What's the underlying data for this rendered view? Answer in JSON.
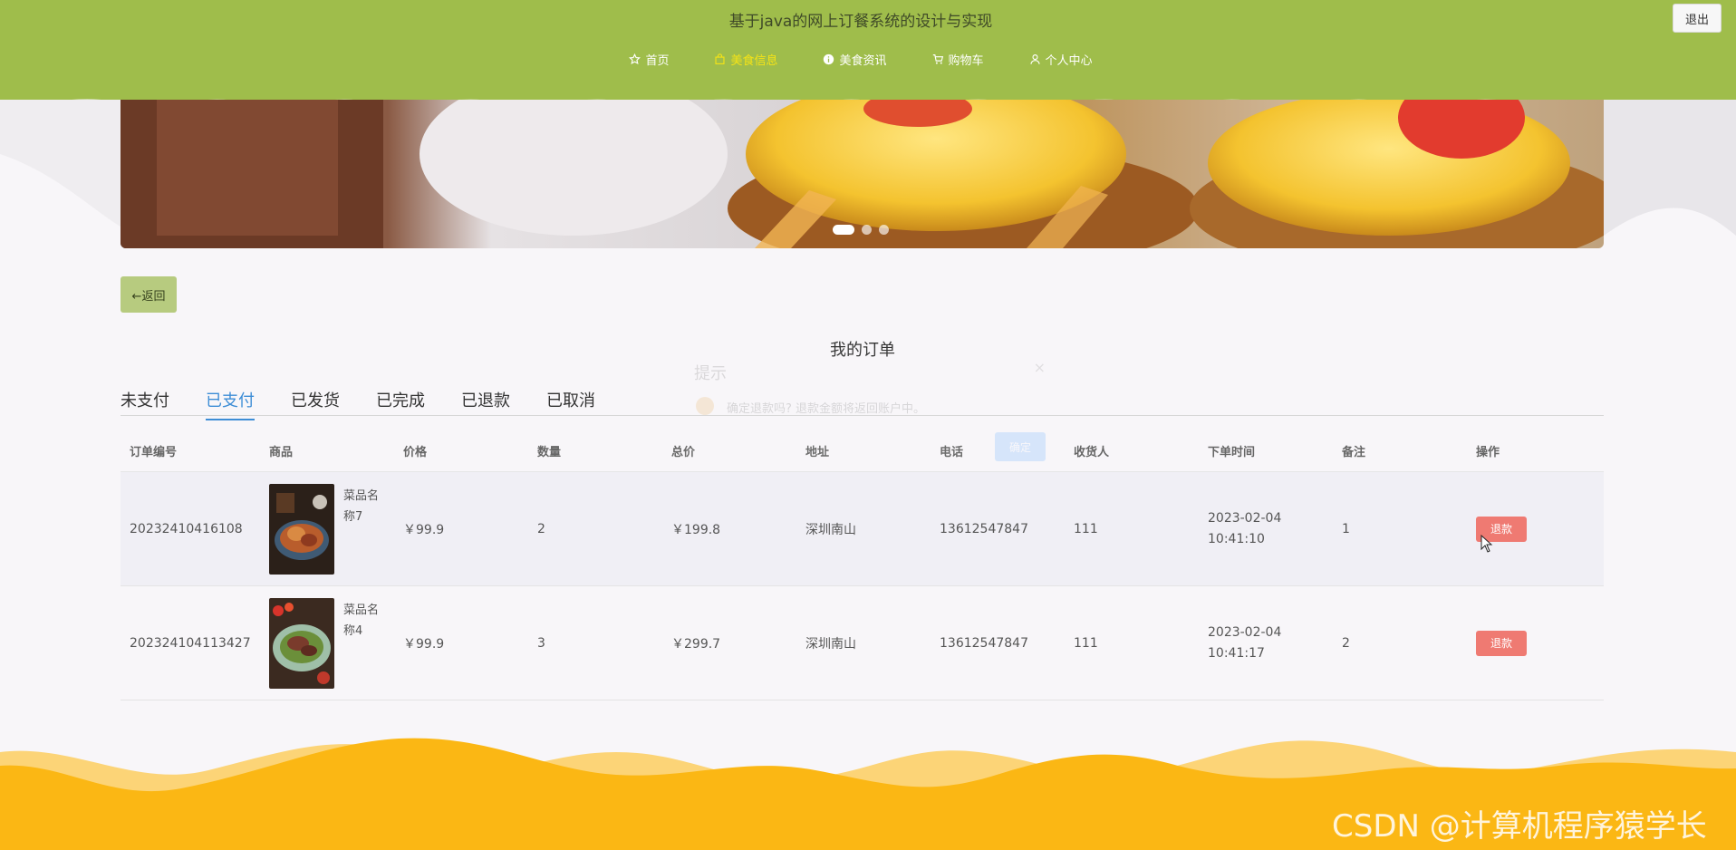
{
  "header": {
    "title": "基于java的网上订餐系统的设计与实现",
    "logout_label": "退出",
    "nav": [
      {
        "label": "首页",
        "icon": "star-icon"
      },
      {
        "label": "美食信息",
        "icon": "bag-icon",
        "active": true
      },
      {
        "label": "美食资讯",
        "icon": "info-icon"
      },
      {
        "label": "购物车",
        "icon": "cart-icon"
      },
      {
        "label": "个人中心",
        "icon": "user-icon"
      }
    ],
    "color": "#9fbd4b",
    "active_color": "#f5e316"
  },
  "back_label": "←返回",
  "section_title": "我的订单",
  "tabs": [
    {
      "label": "未支付"
    },
    {
      "label": "已支付",
      "active": true
    },
    {
      "label": "已发货"
    },
    {
      "label": "已完成"
    },
    {
      "label": "已退款"
    },
    {
      "label": "已取消"
    }
  ],
  "table": {
    "headers": [
      "订单编号",
      "商品",
      "价格",
      "数量",
      "总价",
      "地址",
      "电话",
      "收货人",
      "下单时间",
      "备注",
      "操作"
    ],
    "rows": [
      {
        "order_no": "20232410416108",
        "goods_name": "菜品名称7",
        "price": "￥99.9",
        "qty": "2",
        "total": "￥199.8",
        "address": "深圳南山",
        "phone": "13612547847",
        "receiver": "111",
        "time": "2023-02-04 10:41:10",
        "note": "1",
        "action": "退款"
      },
      {
        "order_no": "202324104113427",
        "goods_name": "菜品名称4",
        "price": "￥99.9",
        "qty": "3",
        "total": "￥299.7",
        "address": "深圳南山",
        "phone": "13612547847",
        "receiver": "111",
        "time": "2023-02-04 10:41:17",
        "note": "2",
        "action": "退款"
      }
    ]
  },
  "dialog": {
    "title": "提示",
    "close": "×",
    "message": "确定退款吗? 退款金额将返回账户中。",
    "ok_label": "确定"
  },
  "watermark": "CSDN @计算机程序猿学长",
  "colors": {
    "refund": "#ef7a72",
    "tab_active": "#3d8dd6",
    "footer": "#fbb714"
  }
}
